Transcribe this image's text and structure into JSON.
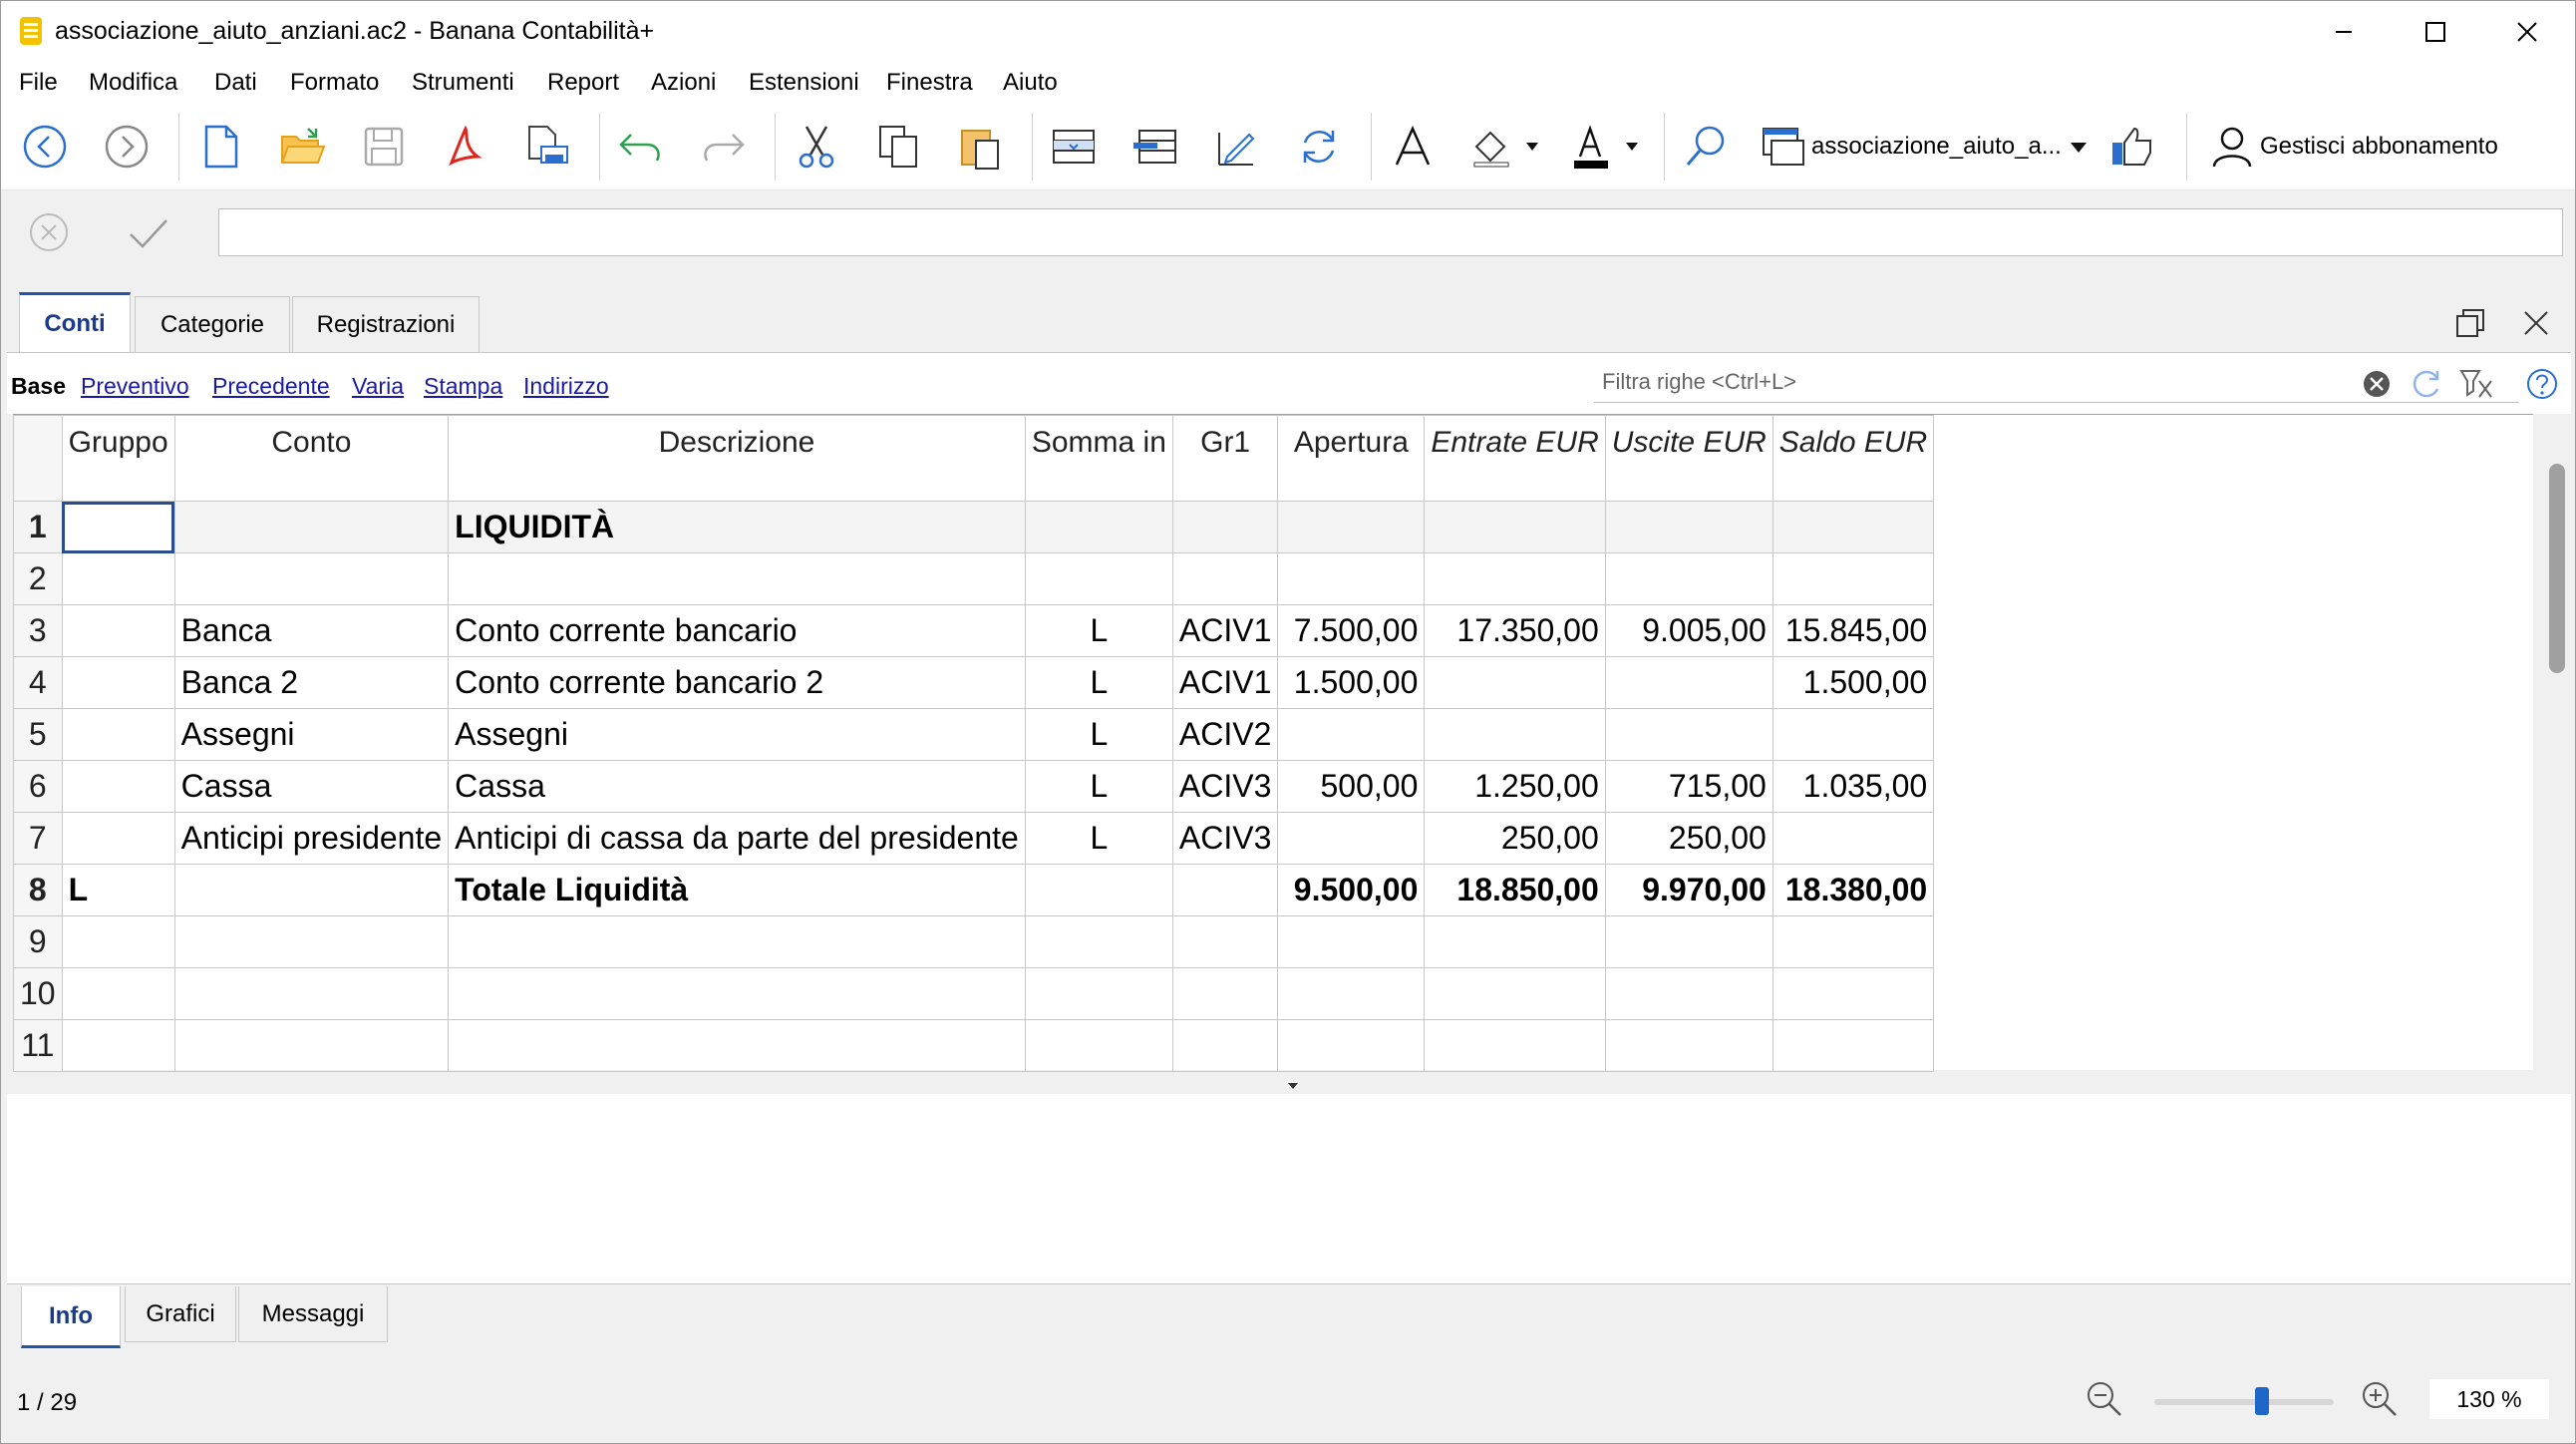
{
  "window": {
    "title": "associazione_aiuto_anziani.ac2 - Banana Contabilità+"
  },
  "menu": [
    "File",
    "Modifica",
    "Dati",
    "Formato",
    "Strumenti",
    "Report",
    "Azioni",
    "Estensioni",
    "Finestra",
    "Aiuto"
  ],
  "toolbar": {
    "document_selector": "associazione_aiuto_a...",
    "subscription_label": "Gestisci abbonamento"
  },
  "formula_bar": {
    "value": ""
  },
  "tabs": [
    {
      "label": "Conti",
      "active": true
    },
    {
      "label": "Categorie",
      "active": false
    },
    {
      "label": "Registrazioni",
      "active": false
    }
  ],
  "views": [
    {
      "label": "Base",
      "active": true
    },
    {
      "label": "Preventivo",
      "active": false
    },
    {
      "label": "Precedente",
      "active": false
    },
    {
      "label": "Varia",
      "active": false
    },
    {
      "label": "Stampa",
      "active": false
    },
    {
      "label": "Indirizzo",
      "active": false
    }
  ],
  "filter": {
    "placeholder": "Filtra righe <Ctrl+L>"
  },
  "table": {
    "columns": [
      "Gruppo",
      "Conto",
      "Descrizione",
      "Somma in",
      "Gr1",
      "Apertura",
      "Entrate EUR",
      "Uscite EUR",
      "Saldo EUR"
    ],
    "rows": [
      {
        "n": "1",
        "gruppo": "",
        "conto": "",
        "descrizione": "LIQUIDITÀ",
        "somma": "",
        "gr1": "",
        "apertura": "",
        "entrate": "",
        "uscite": "",
        "saldo": ""
      },
      {
        "n": "2",
        "gruppo": "",
        "conto": "",
        "descrizione": "",
        "somma": "",
        "gr1": "",
        "apertura": "",
        "entrate": "",
        "uscite": "",
        "saldo": ""
      },
      {
        "n": "3",
        "gruppo": "",
        "conto": "Banca",
        "descrizione": "Conto corrente bancario",
        "somma": "L",
        "gr1": "ACIV1",
        "apertura": "7.500,00",
        "entrate": "17.350,00",
        "uscite": "9.005,00",
        "saldo": "15.845,00"
      },
      {
        "n": "4",
        "gruppo": "",
        "conto": "Banca 2",
        "descrizione": "Conto corrente bancario 2",
        "somma": "L",
        "gr1": "ACIV1",
        "apertura": "1.500,00",
        "entrate": "",
        "uscite": "",
        "saldo": "1.500,00"
      },
      {
        "n": "5",
        "gruppo": "",
        "conto": "Assegni",
        "descrizione": "Assegni",
        "somma": "L",
        "gr1": "ACIV2",
        "apertura": "",
        "entrate": "",
        "uscite": "",
        "saldo": ""
      },
      {
        "n": "6",
        "gruppo": "",
        "conto": "Cassa",
        "descrizione": "Cassa",
        "somma": "L",
        "gr1": "ACIV3",
        "apertura": "500,00",
        "entrate": "1.250,00",
        "uscite": "715,00",
        "saldo": "1.035,00"
      },
      {
        "n": "7",
        "gruppo": "",
        "conto": "Anticipi presidente",
        "descrizione": "Anticipi di cassa da parte del presidente",
        "somma": "L",
        "gr1": "ACIV3",
        "apertura": "",
        "entrate": "250,00",
        "uscite": "250,00",
        "saldo": ""
      },
      {
        "n": "8",
        "gruppo": "L",
        "conto": "",
        "descrizione": "Totale Liquidità",
        "somma": "",
        "gr1": "",
        "apertura": "9.500,00",
        "entrate": "18.850,00",
        "uscite": "9.970,00",
        "saldo": "18.380,00"
      },
      {
        "n": "9",
        "gruppo": "",
        "conto": "",
        "descrizione": "",
        "somma": "",
        "gr1": "",
        "apertura": "",
        "entrate": "",
        "uscite": "",
        "saldo": ""
      },
      {
        "n": "10",
        "gruppo": "",
        "conto": "",
        "descrizione": "",
        "somma": "",
        "gr1": "",
        "apertura": "",
        "entrate": "",
        "uscite": "",
        "saldo": ""
      },
      {
        "n": "11",
        "gruppo": "",
        "conto": "",
        "descrizione": "",
        "somma": "",
        "gr1": "",
        "apertura": "",
        "entrate": "",
        "uscite": "",
        "saldo": ""
      }
    ]
  },
  "bottom_tabs": [
    {
      "label": "Info",
      "active": true
    },
    {
      "label": "Grafici",
      "active": false
    },
    {
      "label": "Messaggi",
      "active": false
    }
  ],
  "status": {
    "row_position": "1 / 29",
    "zoom": "130 %",
    "zoom_level": 0.6
  }
}
